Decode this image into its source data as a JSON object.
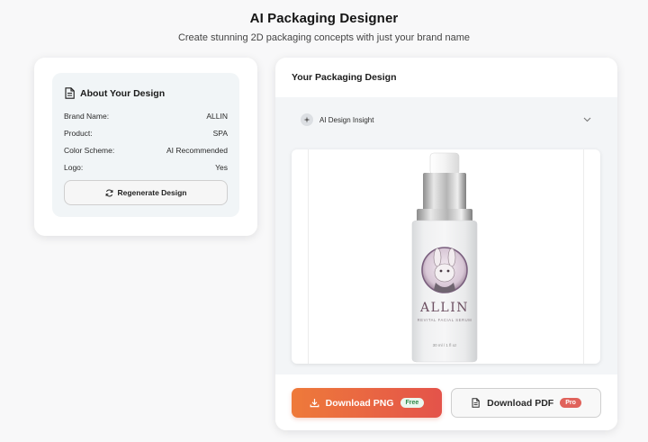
{
  "header": {
    "title": "AI Packaging Designer",
    "subtitle": "Create stunning 2D packaging concepts with just your brand name"
  },
  "about": {
    "title": "About Your Design",
    "rows": [
      {
        "label": "Brand Name:",
        "value": "ALLIN"
      },
      {
        "label": "Product:",
        "value": "SPA"
      },
      {
        "label": "Color Scheme:",
        "value": "AI Recommended"
      },
      {
        "label": "Logo:",
        "value": "Yes"
      }
    ],
    "regenerate_label": "Regenerate Design"
  },
  "design": {
    "title": "Your Packaging Design",
    "insight_label": "AI Design Insight",
    "bottle": {
      "brand": "ALLIN",
      "product_line": "REVITAL FACIAL SERUM",
      "volume": "30 ml / 1 fl oz"
    }
  },
  "actions": {
    "png_label": "Download PNG",
    "png_badge": "Free",
    "pdf_label": "Download PDF",
    "pdf_badge": "Pro"
  },
  "icons": {
    "about": "document-icon",
    "regenerate": "refresh-icon",
    "insight": "sparkle-icon",
    "expand": "chevron-down-icon",
    "png": "download-icon",
    "pdf": "file-icon"
  },
  "colors": {
    "primary_gradient_start": "#ee7a3a",
    "primary_gradient_end": "#e4534a",
    "free_badge": "#2f8a49",
    "pro_badge": "#e0625b"
  }
}
